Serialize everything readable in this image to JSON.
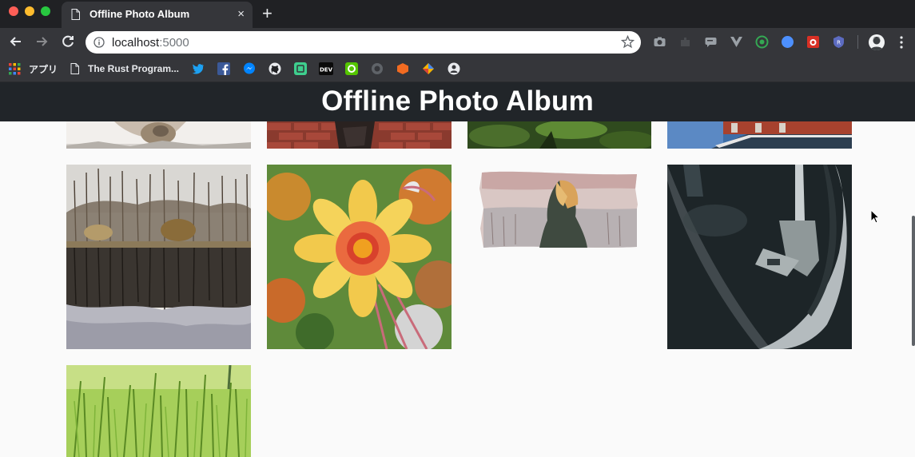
{
  "browser": {
    "tab_title": "Offline Photo Album",
    "new_tab_symbol": "+",
    "close_symbol": "×",
    "url_host": "localhost",
    "url_port": ":5000"
  },
  "bookmarks": {
    "apps_label": "アプリ",
    "rust_label": "The Rust Program..."
  },
  "extensions": [
    "camera-icon",
    "puzzle-icon",
    "chat-icon",
    "vue-icon",
    "target-icon",
    "compass-icon",
    "bug-icon",
    "shield-icon"
  ],
  "page": {
    "title": "Offline Photo Album"
  },
  "photos": [
    {
      "name": "photo-top-1",
      "desc": "partially scrolled image"
    },
    {
      "name": "photo-top-2",
      "desc": "partially scrolled image"
    },
    {
      "name": "photo-top-3",
      "desc": "partially scrolled image"
    },
    {
      "name": "photo-top-4",
      "desc": "partially scrolled image"
    },
    {
      "name": "photo-lake"
    },
    {
      "name": "photo-flower"
    },
    {
      "name": "photo-painting"
    },
    {
      "name": "photo-turntable"
    },
    {
      "name": "photo-grass"
    }
  ],
  "colors": {
    "tabstrip": "#202124",
    "toolbar": "#35363a",
    "header": "#212529",
    "page_bg": "#fafafa"
  }
}
